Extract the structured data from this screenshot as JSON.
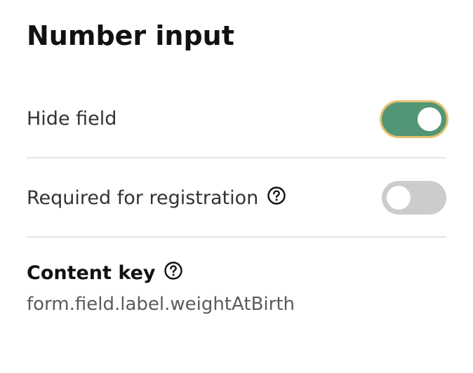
{
  "panel": {
    "title": "Number input"
  },
  "settings": {
    "hide_field": {
      "label": "Hide field",
      "state": "on"
    },
    "required": {
      "label": "Required for registration",
      "state": "off",
      "help_icon": "help-circle-icon"
    }
  },
  "content_key": {
    "title": "Content key",
    "value": "form.field.label.weightAtBirth",
    "help_icon": "help-circle-icon"
  },
  "colors": {
    "toggle_on": "#539675",
    "toggle_focus_ring": "#e3c26f",
    "toggle_off": "#cccccc",
    "divider": "#e4e4e4"
  }
}
